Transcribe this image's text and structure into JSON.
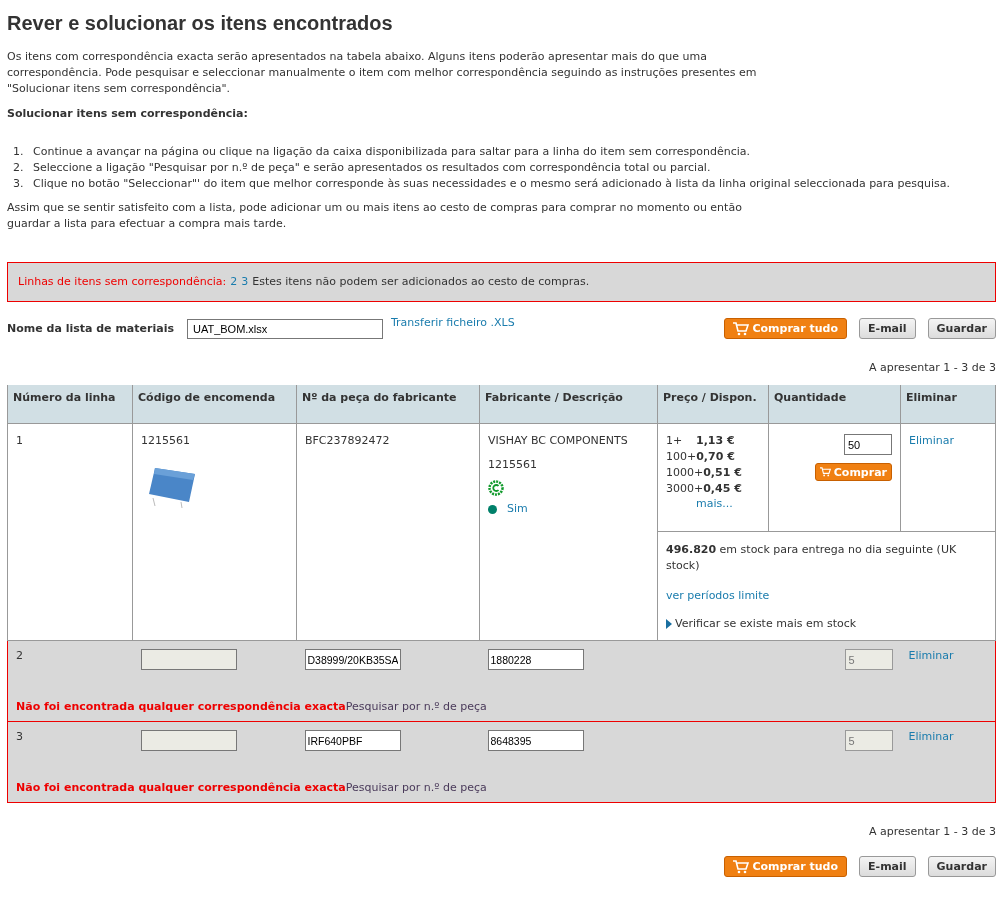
{
  "title": "Rever e solucionar os itens encontrados",
  "intro": "Os itens com correspondência exacta serão apresentados na tabela abaixo. Alguns itens poderão apresentar mais do que uma correspondência. Pode pesquisar e seleccionar manualmente o item com melhor correspondência seguindo as instruções presentes em \"Solucionar itens sem correspondência\".",
  "steps_heading": "Solucionar itens sem correspondência:",
  "steps": [
    {
      "number": "1.",
      "text": "Continue a avançar na página ou clique na ligação da caixa disponibilizada para saltar para a linha do item sem correspondência."
    },
    {
      "number": "2.",
      "text": "Seleccione a ligação \"Pesquisar por n.º de peça\" e serão apresentados os resultados com correspondência total ou parcial."
    },
    {
      "number": "3.",
      "text": "Clique no botão \"Seleccionar\"' do item que melhor corresponde às suas necessidades e o mesmo será adicionado à lista da linha original seleccionada para pesquisa."
    }
  ],
  "outro": "Assim que se sentir satisfeito com a lista, pode adicionar um ou mais itens ao cesto de compras para comprar no momento ou então guardar a lista para efectuar a compra mais tarde.",
  "alert": {
    "label": "Linhas de itens sem correspondência:",
    "links": [
      "2",
      "3"
    ],
    "text": "Estes itens não podem ser adicionados ao cesto de compras."
  },
  "list_name": {
    "label": "Nome da lista de materiais",
    "value": "UAT_BOM.xlsx",
    "download_link": "Transferir ficheiro .XLS"
  },
  "top_buttons": [
    {
      "kind": "primary",
      "label": "Comprar tudo"
    },
    {
      "kind": "plain",
      "label": "E-mail"
    },
    {
      "kind": "plain",
      "label": "Guardar"
    }
  ],
  "pagination_top": "A apresentar 1 - 3 de 3",
  "table": {
    "columns": [
      "Número da linha",
      "Código de encomenda",
      "Nº da peça do fabricante",
      "Fabricante / Descrição",
      "Preço / Dispon.",
      "Quantidade",
      "Eliminar"
    ],
    "rows": [
      {
        "kind": "matched",
        "line": "1",
        "order_code": "1215561",
        "mfr_part": "BFC237892472",
        "manufacturer": "VISHAY BC COMPONENTS",
        "description": "1215561",
        "availability_link": "Sim",
        "prices": [
          {
            "qty": "1+",
            "price": "1,13 €"
          },
          {
            "qty": "100+",
            "price": "0,70 €"
          },
          {
            "qty": "1000+",
            "price": "0,51 €"
          },
          {
            "qty": "3000+",
            "price": "0,45 €"
          }
        ],
        "more_link": "mais...",
        "quantity": "50",
        "buy_button": "Comprar",
        "delete_link": "Eliminar",
        "stock_amount": "496.820",
        "stock_text": "em stock para entrega no dia seguinte (UK stock)",
        "lead_time_link": "ver períodos limite",
        "check_stock": "Verificar se existe mais em stock"
      },
      {
        "kind": "unmatched",
        "line": "2",
        "mfr_part": "D38999/20KB35SA",
        "manufacturer": "1880228",
        "quantity": "5",
        "delete_link": "Eliminar",
        "message": "Não foi encontrada qualquer correspondência exacta",
        "search_link": "Pesquisar por n.º de peça"
      },
      {
        "kind": "unmatched",
        "line": "3",
        "mfr_part": "IRF640PBF",
        "manufacturer": "8648395",
        "quantity": "5",
        "delete_link": "Eliminar",
        "message": "Não foi encontrada qualquer correspondência exacta",
        "search_link": "Pesquisar por n.º de peça"
      }
    ]
  },
  "pagination_bottom": "A apresentar 1 - 3 de 3",
  "bottom_buttons": [
    {
      "kind": "primary",
      "label": "Comprar tudo"
    },
    {
      "kind": "plain",
      "label": "E-mail"
    },
    {
      "kind": "plain",
      "label": "Guardar"
    }
  ]
}
